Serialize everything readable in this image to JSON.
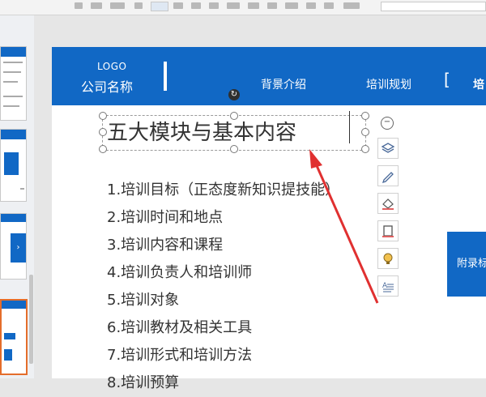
{
  "slide": {
    "logo": "LOGO",
    "company": "公司名称",
    "nav": [
      "背景介绍",
      "培训规划",
      "[",
      "培"
    ],
    "title": "五大模块与基本内容",
    "items": [
      "1.培训目标（正态度新知识提技能）",
      "2.培训时间和地点",
      "3.培训内容和课程",
      "4.培训负责人和培训师",
      "5.培训对象",
      "6.培训教材及相关工具",
      "7.培训形式和培训方法",
      "8.培训预算"
    ],
    "card_label": "附录标"
  },
  "tools": [
    "layers-icon",
    "pen-icon",
    "eraser-icon",
    "frame-icon",
    "bulb-icon",
    "text-format-icon"
  ],
  "colors": {
    "banner": "#1168c5",
    "thumb_selected_border": "#e46d2b",
    "arrow": "#e03030"
  }
}
